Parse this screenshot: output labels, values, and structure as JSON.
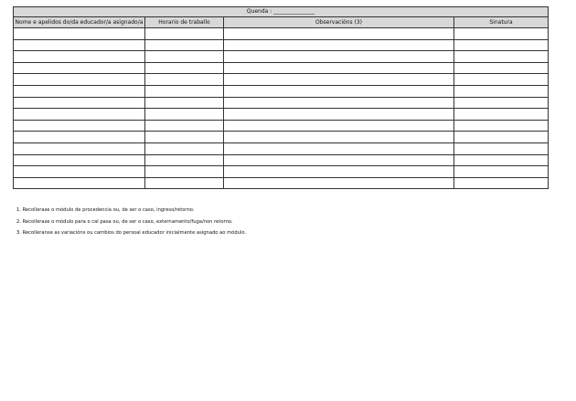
{
  "shift": {
    "label": "Quenda : _______________"
  },
  "table": {
    "columns": [
      "Nome e apelidos do/da educador/a asignado/a",
      "Horario de traballo",
      "Observacións (3)",
      "Sinatura"
    ],
    "empty_rows": 14
  },
  "notes": [
    "1. Recollerase o módulo de procedencia ou, de ser o caso, ingreso/retorno.",
    "2. Recollerase o módulo para o cal pasa ou, de ser o caso, externamento/fuga/non retorno.",
    "3. Recolleranse as variacións ou cambios do persoal educador inicialmente asignado ao módulo."
  ]
}
